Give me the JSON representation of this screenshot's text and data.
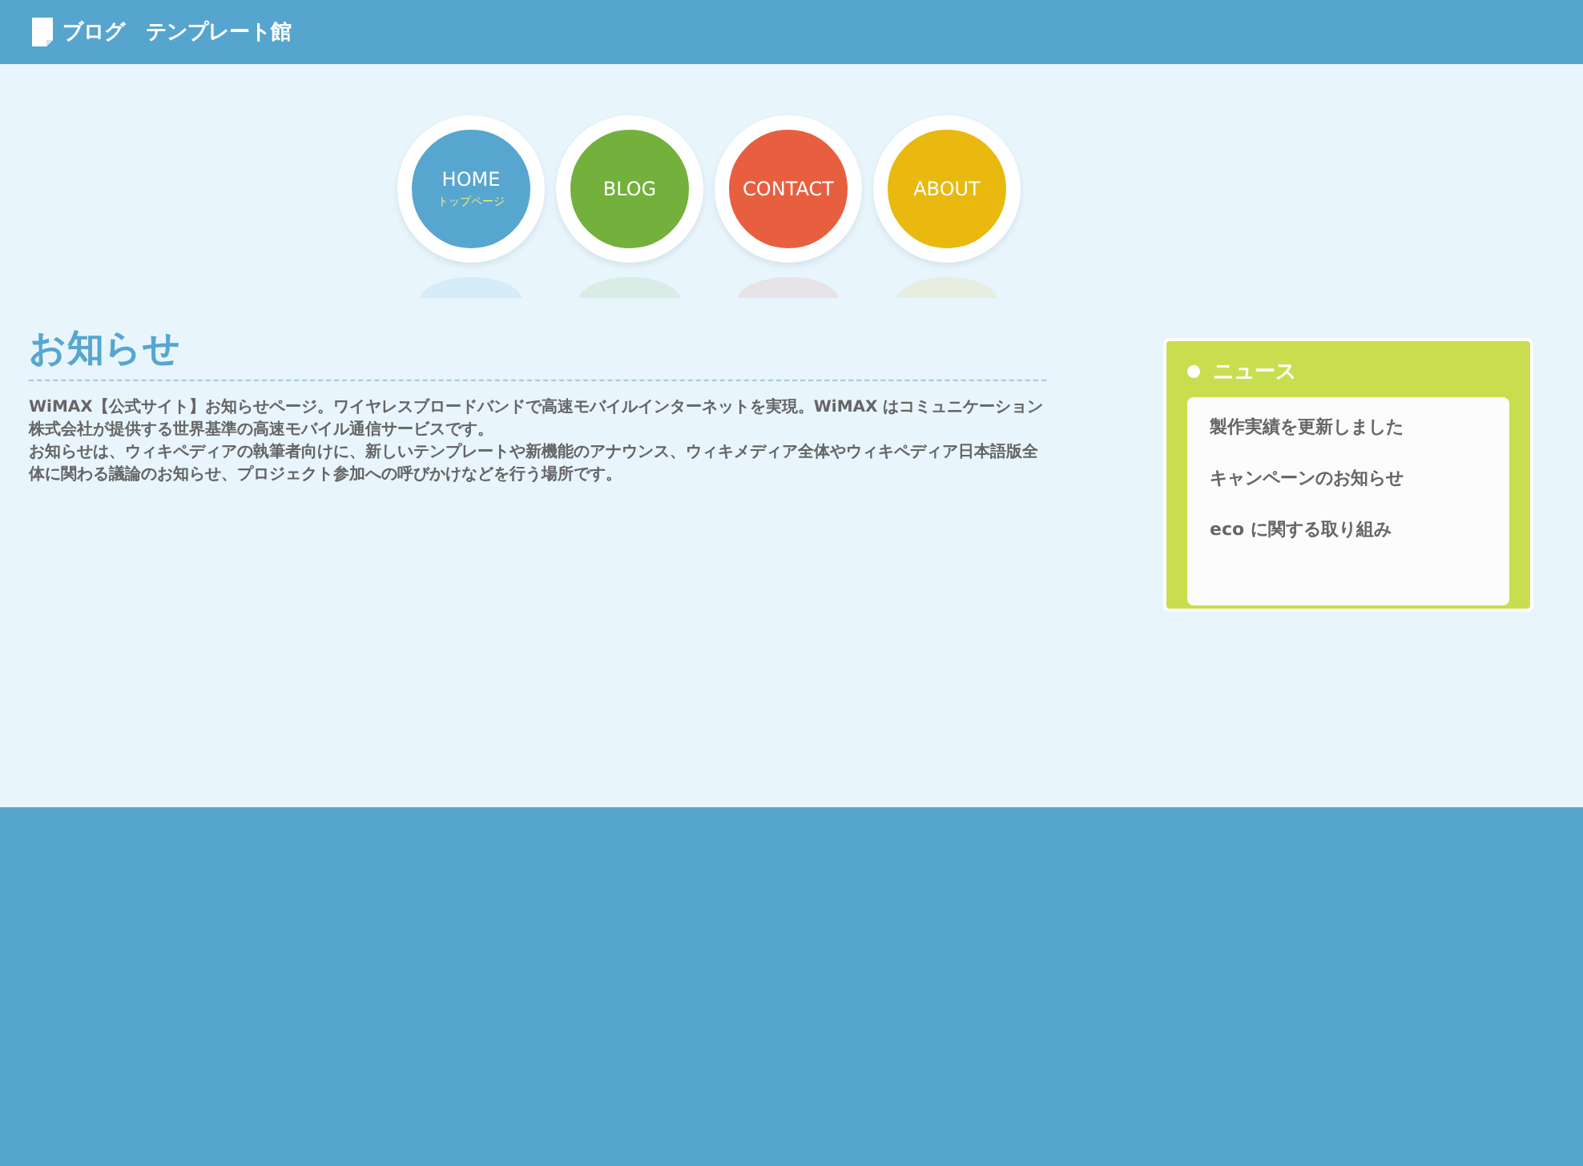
{
  "header": {
    "title": "ブログ　テンプレート館"
  },
  "nav": [
    {
      "label": "HOME",
      "sublabel": "トップページ",
      "color": "#56a6d0"
    },
    {
      "label": "BLOG",
      "color": "#74b03c"
    },
    {
      "label": "CONTACT",
      "color": "#e85f3f"
    },
    {
      "label": "ABOUT",
      "color": "#e9b90f"
    }
  ],
  "main": {
    "heading": "お知らせ",
    "paragraphs": [
      "WiMAX【公式サイト】お知らせページ。ワイヤレスブロードバンドで高速モバイルインターネットを実現。WiMAX はコミュニケーション株式会社が提供する世界基準の高速モバイル通信サービスです。",
      "お知らせは、ウィキペディアの執筆者向けに、新しいテンプレートや新機能のアナウンス、ウィキメディア全体やウィキペディア日本語版全体に関わる議論のお知らせ、プロジェクト参加への呼びかけなどを行う場所です。"
    ]
  },
  "sidebar": {
    "title": "ニュース",
    "items": [
      "製作実績を更新しました",
      "キャンペーンのお知らせ",
      "eco に関する取り組み"
    ]
  }
}
